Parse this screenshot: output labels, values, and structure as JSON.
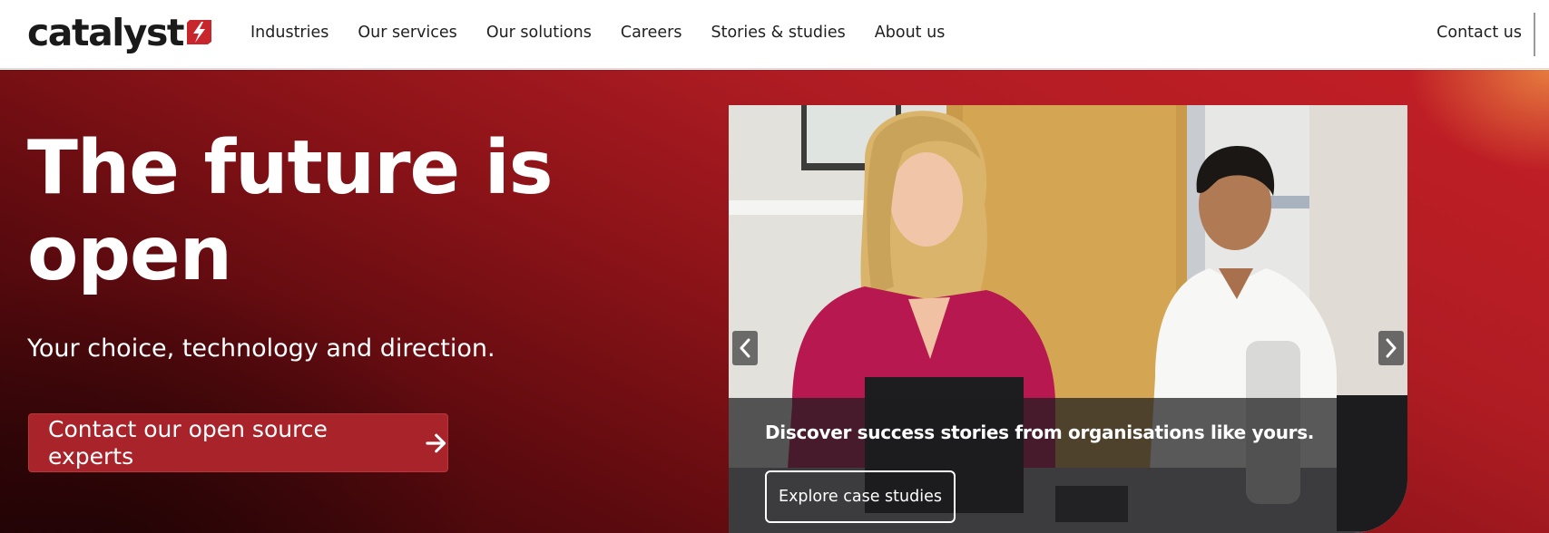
{
  "header": {
    "logo_text": "catalyst",
    "nav": [
      {
        "label": "Industries"
      },
      {
        "label": "Our services"
      },
      {
        "label": "Our solutions"
      },
      {
        "label": "Careers"
      },
      {
        "label": "Stories & studies"
      },
      {
        "label": "About us"
      }
    ],
    "contact_label": "Contact us"
  },
  "hero": {
    "title_line1": "The future is",
    "title_line2": "open",
    "subtitle": "Your choice, technology and direction.",
    "cta_label": "Contact our open source experts"
  },
  "carousel": {
    "caption": "Discover success stories from organisations like yours.",
    "button_label": "Explore case studies",
    "prev_icon": "chevron-left-icon",
    "next_icon": "chevron-right-icon"
  },
  "colors": {
    "brand_red": "#c41f26",
    "cta_bg": "#a8232a",
    "text_dark": "#1f1f1f",
    "text_light": "#ffffff"
  }
}
